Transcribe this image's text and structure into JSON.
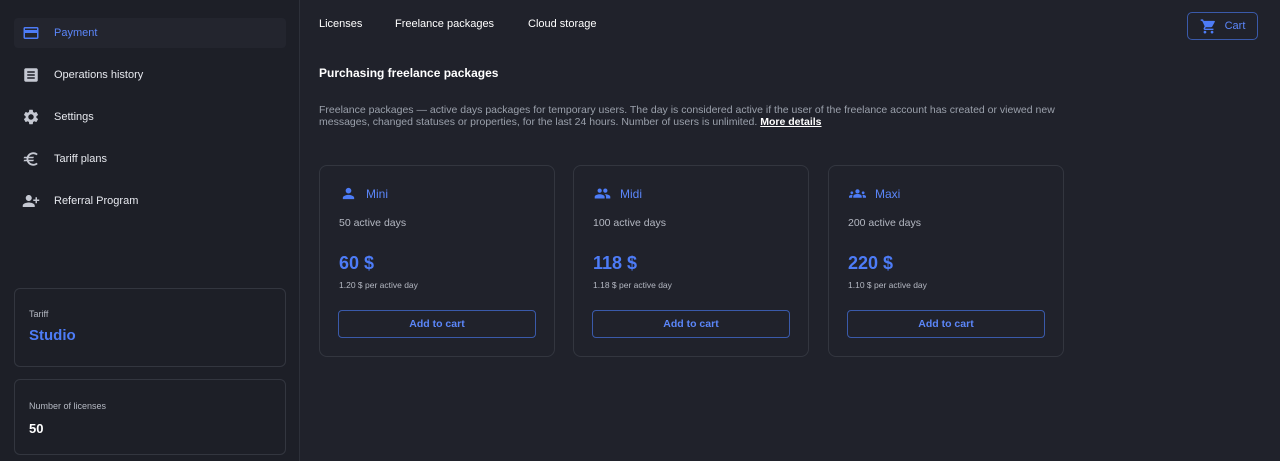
{
  "sidebar": {
    "items": [
      {
        "label": "Payment",
        "icon": "credit-card-icon",
        "active": true
      },
      {
        "label": "Operations history",
        "icon": "list-document-icon"
      },
      {
        "label": "Settings",
        "icon": "gear-icon"
      },
      {
        "label": "Tariff plans",
        "icon": "euro-icon"
      },
      {
        "label": "Referral Program",
        "icon": "person-add-icon"
      }
    ],
    "tariff": {
      "label": "Tariff",
      "value": "Studio"
    },
    "licenses": {
      "label": "Number of licenses",
      "value": "50"
    }
  },
  "tabs": [
    "Licenses",
    "Freelance packages",
    "Cloud storage"
  ],
  "cart": {
    "label": "Cart",
    "icon": "cart-icon"
  },
  "main": {
    "title": "Purchasing freelance packages",
    "description": "Freelance packages — active days packages for temporary users. The day is considered active if the user of the freelance account has created or viewed new messages, changed statuses or properties, for the last 24 hours. Number of users is unlimited.",
    "more_link": "More details"
  },
  "packages": [
    {
      "name": "Mini",
      "icon": "person-icon",
      "days": "50 active days",
      "price": "60 $",
      "per_day": "1.20 $ per active day",
      "button": "Add to cart"
    },
    {
      "name": "Midi",
      "icon": "people-icon",
      "days": "100 active days",
      "price": "118 $",
      "per_day": "1.18 $ per active day",
      "button": "Add to cart"
    },
    {
      "name": "Maxi",
      "icon": "group-icon",
      "days": "200 active days",
      "price": "220 $",
      "per_day": "1.10 $ per active day",
      "button": "Add to cart"
    }
  ],
  "colors": {
    "accent": "#4d7cf7",
    "background": "#20222b",
    "sidebar": "#1d1f27",
    "border": "#33363f"
  }
}
